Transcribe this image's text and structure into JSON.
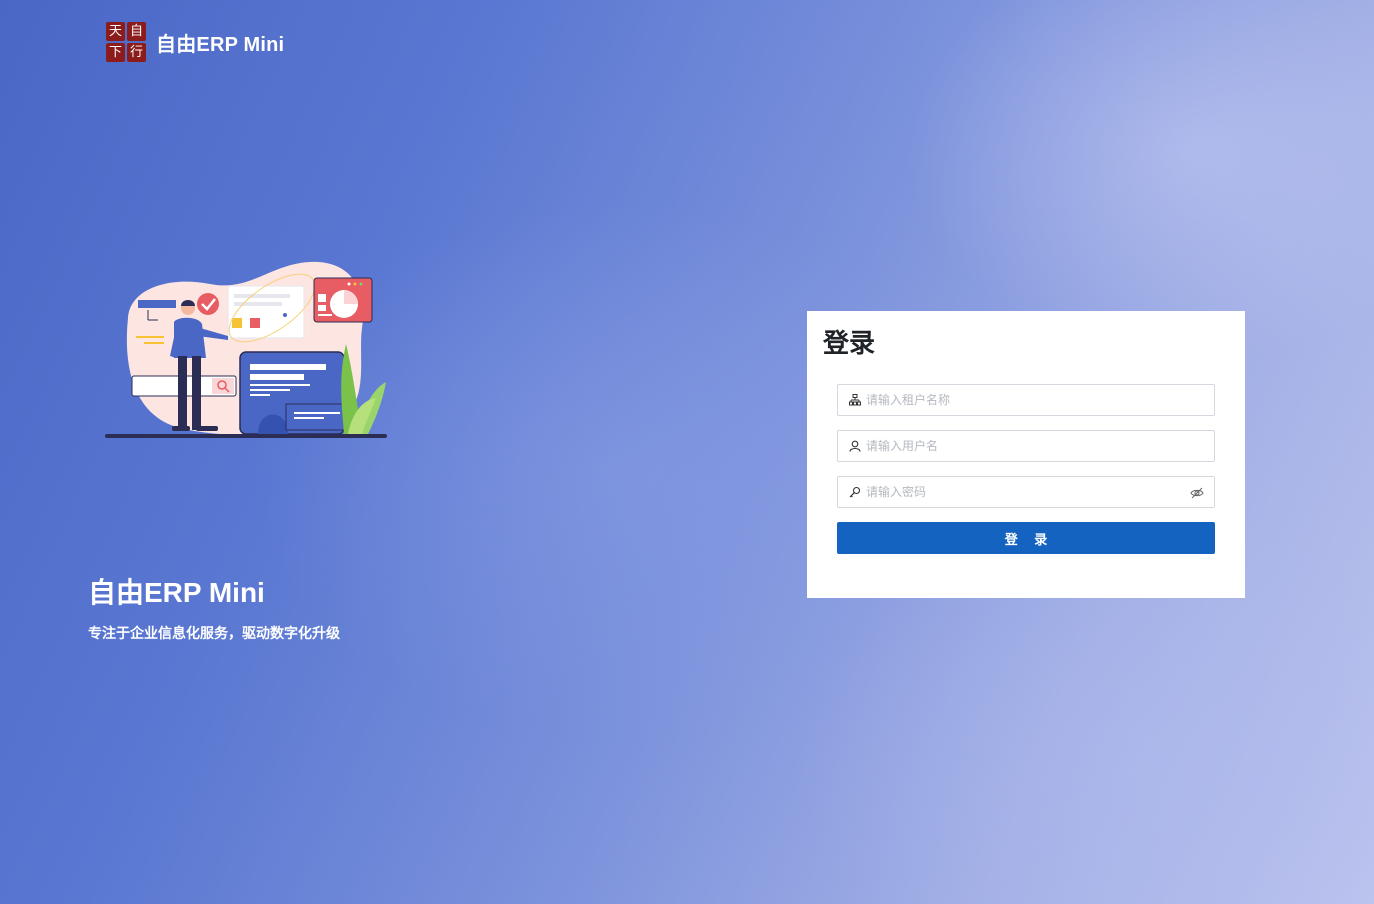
{
  "brand": {
    "logo_chars": [
      "天",
      "自",
      "下",
      "行"
    ],
    "name": "自由ERP Mini"
  },
  "hero": {
    "title": "自由ERP Mini",
    "subtitle": "专注于企业信息化服务，驱动数字化升级"
  },
  "login": {
    "title": "登录",
    "tenant_placeholder": "请输入租户名称",
    "username_placeholder": "请输入用户名",
    "password_placeholder": "请输入密码",
    "button_label": "登 录"
  },
  "colors": {
    "primary": "#1463c0",
    "logo_red": "#8c1c1c",
    "background_start": "#4a67c6",
    "background_end": "#bcc4ee"
  },
  "icons": {
    "tenant": "org-tree-icon",
    "username": "user-icon",
    "password": "key-icon",
    "password_toggle": "eye-off-icon"
  }
}
